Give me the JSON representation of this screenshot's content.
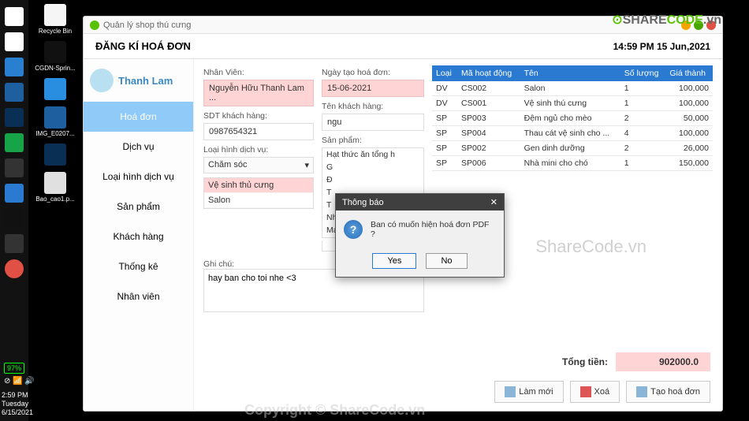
{
  "desktop": {
    "icons": [
      "Recycle Bin",
      "CGDN-Sprin...",
      "",
      "IMG_E0207...",
      "",
      "Bao_cao1.p..."
    ]
  },
  "taskbar": {
    "battery": "97%",
    "time": "2:59 PM",
    "day": "Tuesday",
    "date": "6/15/2021"
  },
  "app": {
    "title": "Quản lý shop thú cưng",
    "header_title": "ĐĂNG KÍ HOÁ ĐƠN",
    "timestamp": "14:59 PM  15 Jun,2021",
    "user_name": "Thanh Lam"
  },
  "nav": {
    "items": [
      "Hoá đơn",
      "Dịch vụ",
      "Loại hình dịch vụ",
      "Sản phẩm",
      "Khách hàng",
      "Thống kê",
      "Nhân viên"
    ]
  },
  "form": {
    "nhan_vien_lbl": "Nhân Viên:",
    "nhan_vien": "Nguyễn Hữu Thanh Lam ...",
    "sdt_lbl": "SDT khách hàng:",
    "sdt": "0987654321",
    "loai_hinh_lbl": "Loại hình dịch vụ:",
    "loai_hinh": "Chăm sóc",
    "service_list": [
      "Vệ sinh thủ cưng",
      "Salon"
    ],
    "ngay_tao_lbl": "Ngày tạo hoá đơn:",
    "ngay_tao": "15-06-2021",
    "ten_kh_lbl": "Tên khách hàng:",
    "ten_kh": "ngu",
    "san_pham_lbl": "Sản phẩm:",
    "products": [
      "Hạt thức ăn tổng h",
      "G",
      "Đ",
      "T",
      "T",
      "Nhà mini cho chó",
      "Máy massage cho"
    ],
    "ghi_chu_lbl": "Ghi chú:",
    "ghi_chu": "hay ban cho toi nhe <3"
  },
  "table": {
    "headers": [
      "Loại",
      "Mã hoạt động",
      "Tên",
      "Số lượng",
      "Giá thành"
    ],
    "rows": [
      {
        "loai": "DV",
        "ma": "CS002",
        "ten": "Salon",
        "sl": "1",
        "gia": "100,000"
      },
      {
        "loai": "DV",
        "ma": "CS001",
        "ten": "Vệ sinh thú cưng",
        "sl": "1",
        "gia": "100,000"
      },
      {
        "loai": "SP",
        "ma": "SP003",
        "ten": "Đệm ngủ cho mèo",
        "sl": "2",
        "gia": "50,000"
      },
      {
        "loai": "SP",
        "ma": "SP004",
        "ten": "Thau cát vệ sinh cho ...",
        "sl": "4",
        "gia": "100,000"
      },
      {
        "loai": "SP",
        "ma": "SP002",
        "ten": "Gen dinh dưỡng",
        "sl": "2",
        "gia": "26,000"
      },
      {
        "loai": "SP",
        "ma": "SP006",
        "ten": "Nhà mini cho chó",
        "sl": "1",
        "gia": "150,000"
      }
    ]
  },
  "total": {
    "label": "Tổng tiền:",
    "value": "902000.0"
  },
  "buttons": {
    "lam_moi": "Làm mới",
    "xoa": "Xoá",
    "tao": "Tạo hoá đơn"
  },
  "dialog": {
    "title": "Thông báo",
    "message": "Ban có muốn hiện hoá đơn PDF ?",
    "yes": "Yes",
    "no": "No"
  },
  "watermarks": {
    "sharecode_logo": "SHARECODE.vn",
    "center": "ShareCode.vn",
    "copyright": "Copyright © ShareCode.vn"
  }
}
